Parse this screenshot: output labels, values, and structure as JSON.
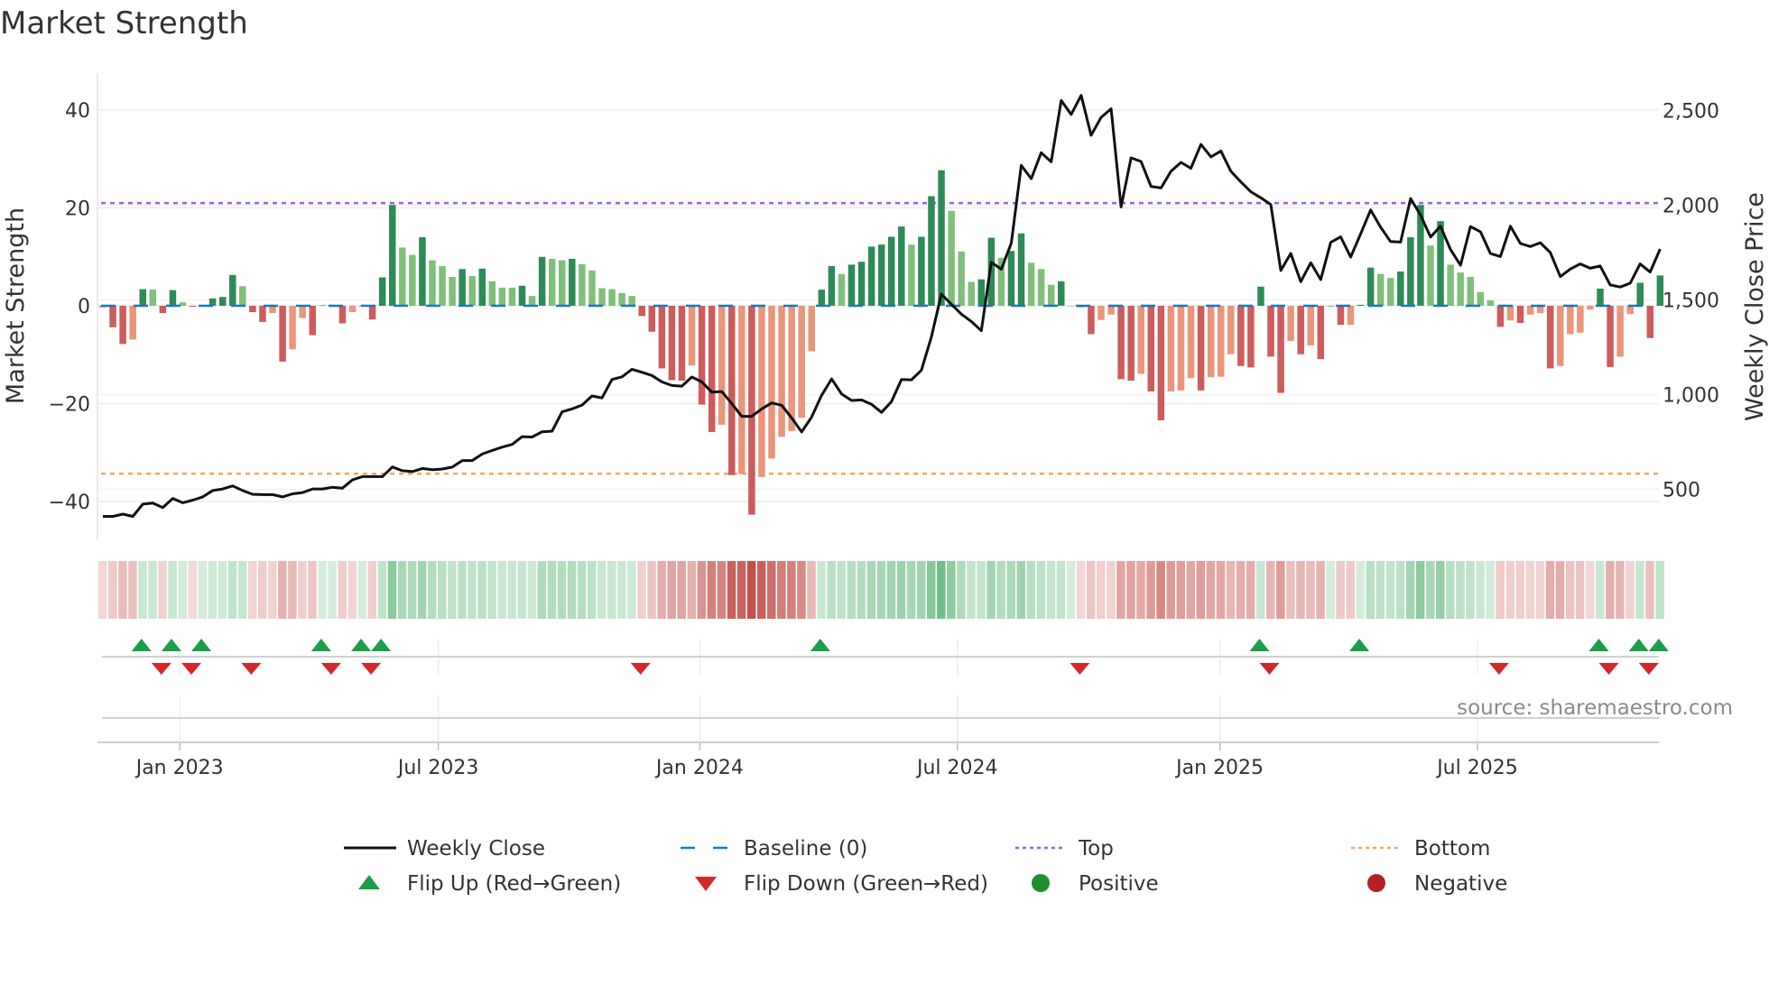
{
  "chart_data": {
    "type": "bar",
    "title": "Market Strength",
    "ylabel": "Market Strength",
    "y2label": "Weekly Close Price",
    "ylim": [
      -48,
      48
    ],
    "y2lim": [
      300,
      2680
    ],
    "yticks": [
      40,
      20,
      0,
      -20,
      -40
    ],
    "yticklabels": [
      "40",
      "20",
      "0",
      "−20",
      "−40"
    ],
    "y2ticks": [
      2500,
      2000,
      1500,
      1000,
      500
    ],
    "y2ticklabels": [
      "2,500",
      "2,000",
      "1,500",
      "1,000",
      "500"
    ],
    "x_unit": "week index",
    "xticks": [
      {
        "label": "Jan 2023",
        "week": 7.7
      },
      {
        "label": "Jul 2023",
        "week": 33.6
      },
      {
        "label": "Jan 2024",
        "week": 59.8
      },
      {
        "label": "Jul 2024",
        "week": 85.6
      },
      {
        "label": "Jan 2025",
        "week": 111.9
      },
      {
        "label": "Jul 2025",
        "week": 137.7
      }
    ],
    "top_level": 21,
    "bottom_level": -34.3,
    "baseline": 0,
    "strength": [
      -0.3,
      -4.4,
      -7.8,
      -6.9,
      3.4,
      3.3,
      -1.5,
      3.2,
      0.7,
      -0.2,
      0,
      1.5,
      1.8,
      6.3,
      4.0,
      -1.3,
      -3.3,
      -1.5,
      -11.4,
      -8.9,
      -2.5,
      -6,
      0.1,
      0,
      -3.6,
      -1.3,
      0,
      -2.8,
      5.8,
      20.6,
      11.9,
      10.4,
      14,
      9.3,
      8.1,
      5.9,
      7.5,
      6.1,
      7.6,
      5.0,
      3.7,
      3.7,
      4.1,
      2.0,
      10,
      9.6,
      9.3,
      9.6,
      8.5,
      7.2,
      3.6,
      3.4,
      2.6,
      2.0,
      -2.1,
      -5.3,
      -12.8,
      -15.2,
      -15.3,
      -12.2,
      -20.2,
      -25.8,
      -24.3,
      -34.6,
      -34.4,
      -42.7,
      -35.0,
      -31.2,
      -26.8,
      -25.6,
      -22.9,
      -9.3,
      3.3,
      8.1,
      6.5,
      8.4,
      9.0,
      12.1,
      12.5,
      14.1,
      16.2,
      12.5,
      14.1,
      22.4,
      27.7,
      19.4,
      11.1,
      4.9,
      5.4,
      13.9,
      9.8,
      11.2,
      14.8,
      8.8,
      7.5,
      4.3,
      5.0,
      0,
      -0.3,
      -5.8,
      -2.9,
      -1.8,
      -15,
      -15.3,
      -13.9,
      -17.5,
      -23.4,
      -17.5,
      -17.3,
      -14.8,
      -17.3,
      -14.6,
      -14.5,
      -9.9,
      -12.3,
      -12.6,
      3.9,
      -10.4,
      -17.8,
      -7.2,
      -9.9,
      -8.1,
      -10.9,
      0,
      -3.9,
      -3.9,
      0.2,
      7.8,
      6.5,
      5.7,
      7.0,
      14.0,
      20.6,
      12.3,
      17.3,
      8.4,
      6.8,
      5.9,
      2.8,
      1.1,
      -4.3,
      -3.0,
      -3.5,
      -1.8,
      -1.5,
      -12.8,
      -12.3,
      -5.8,
      -5.5,
      -0.8,
      3.5,
      -12.5,
      -10.4,
      -1.7,
      4.7,
      -6.6,
      6.2
    ],
    "weekly_close": [
      357,
      357,
      369,
      357,
      422,
      427,
      404,
      452,
      429,
      443,
      460,
      494,
      502,
      518,
      494,
      474,
      472,
      472,
      460,
      476,
      483,
      502,
      502,
      511,
      506,
      550,
      567,
      567,
      567,
      618,
      598,
      594,
      610,
      604,
      607,
      617,
      652,
      652,
      686,
      705,
      723,
      737,
      778,
      776,
      804,
      807,
      909,
      925,
      945,
      993,
      983,
      1080,
      1094,
      1134,
      1118,
      1101,
      1067,
      1048,
      1045,
      1093,
      1067,
      1013,
      1016,
      953,
      885,
      885,
      925,
      956,
      944,
      877,
      803,
      882,
      996,
      1083,
      1004,
      969,
      972,
      949,
      906,
      963,
      1080,
      1078,
      1129,
      1305,
      1531,
      1477,
      1425,
      1386,
      1337,
      1699,
      1662,
      1800,
      2210,
      2140,
      2277,
      2229,
      2553,
      2479,
      2580,
      2369,
      2464,
      2509,
      1991,
      2250,
      2231,
      2099,
      2091,
      2179,
      2226,
      2195,
      2321,
      2255,
      2286,
      2179,
      2123,
      2071,
      2039,
      2004,
      1655,
      1745,
      1596,
      1696,
      1607,
      1804,
      1833,
      1726,
      1849,
      1975,
      1884,
      1808,
      1805,
      2035,
      1948,
      1832,
      1889,
      1766,
      1683,
      1887,
      1860,
      1745,
      1729,
      1889,
      1798,
      1782,
      1802,
      1750,
      1623,
      1663,
      1690,
      1667,
      1679,
      1579,
      1568,
      1588,
      1690,
      1647,
      1769
    ],
    "flip_up_weeks": [
      4,
      7,
      10,
      22,
      26,
      28,
      72,
      116,
      126,
      150,
      154,
      156
    ],
    "flip_down_weeks": [
      6,
      9,
      15,
      23,
      27,
      54,
      98,
      117,
      140,
      151,
      155
    ],
    "colors": {
      "pos_strong": "#2e8b57",
      "pos_weak": "#80bf7b",
      "neg_strong": "#cd5c5c",
      "neg_weak": "#e9967a",
      "close": "#111111",
      "baseline": "#1f77b4",
      "top": "#9b5fe0",
      "bottom": "#f4a460",
      "flip_up": "#1a9e4a",
      "flip_down": "#d62728",
      "positive": "#1e8f2e",
      "negative": "#b22222"
    },
    "legend": [
      {
        "label": "Weekly Close",
        "kind": "line"
      },
      {
        "label": "Baseline (0)",
        "kind": "baseline"
      },
      {
        "label": "Top",
        "kind": "top"
      },
      {
        "label": "Bottom",
        "kind": "bottom"
      },
      {
        "label": "Flip Up (Red→Green)",
        "kind": "up"
      },
      {
        "label": "Flip Down (Green→Red)",
        "kind": "down"
      },
      {
        "label": "Positive",
        "kind": "positive"
      },
      {
        "label": "Negative",
        "kind": "negative"
      }
    ],
    "legend_placement": "bottom",
    "source": "source: sharemaestro.com"
  }
}
